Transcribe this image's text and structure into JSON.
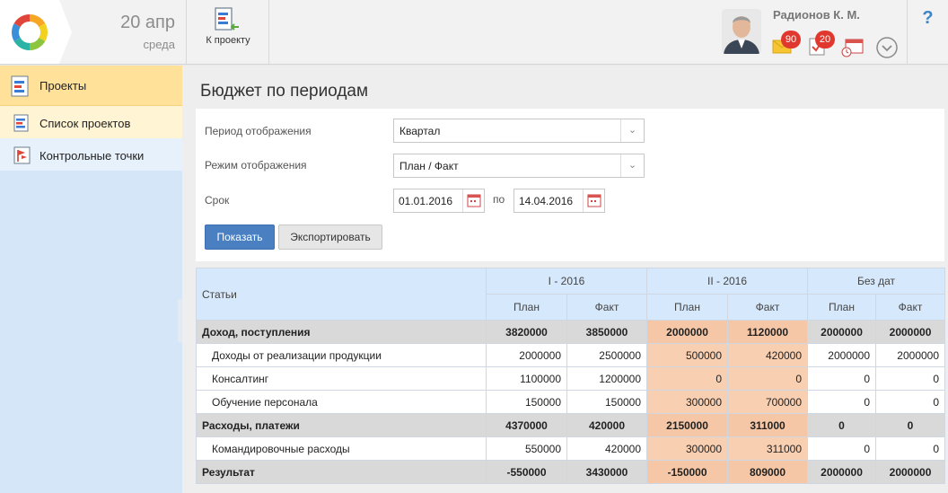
{
  "header": {
    "date_day": "20 апр",
    "date_weekday": "среда",
    "to_project_label": "К проекту",
    "user_name": "Радионов К. М.",
    "mail_badge": "90",
    "tasks_badge": "20",
    "help_label": "?"
  },
  "sidebar": {
    "main_item": "Проекты",
    "items": [
      {
        "label": "Список проектов"
      },
      {
        "label": "Контрольные точки"
      }
    ]
  },
  "page": {
    "title": "Бюджет по периодам"
  },
  "form": {
    "period_label": "Период отображения",
    "period_value": "Квартал",
    "mode_label": "Режим отображения",
    "mode_value": "План / Факт",
    "term_label": "Срок",
    "date_from": "01.01.2016",
    "to_label": "по",
    "date_to": "14.04.2016",
    "show_button": "Показать",
    "export_button": "Экспортировать"
  },
  "table": {
    "items_header": "Статьи",
    "periods": [
      "I - 2016",
      "II - 2016",
      "Без дат"
    ],
    "plan": "План",
    "fact": "Факт",
    "rows": [
      {
        "name": "Доход, поступления",
        "group": true,
        "values": [
          "3820000",
          "3850000",
          "2000000",
          "1120000",
          "2000000",
          "2000000"
        ]
      },
      {
        "name": "Доходы от реализации продукции",
        "group": false,
        "values": [
          "2000000",
          "2500000",
          "500000",
          "420000",
          "2000000",
          "2000000"
        ]
      },
      {
        "name": "Консалтинг",
        "group": false,
        "values": [
          "1100000",
          "1200000",
          "0",
          "0",
          "0",
          "0"
        ]
      },
      {
        "name": "Обучение персонала",
        "group": false,
        "values": [
          "150000",
          "150000",
          "300000",
          "700000",
          "0",
          "0"
        ]
      },
      {
        "name": "Расходы, платежи",
        "group": true,
        "values": [
          "4370000",
          "420000",
          "2150000",
          "311000",
          "0",
          "0"
        ]
      },
      {
        "name": "Командировочные расходы",
        "group": false,
        "values": [
          "550000",
          "420000",
          "300000",
          "311000",
          "0",
          "0"
        ]
      },
      {
        "name": "Результат",
        "group": true,
        "values": [
          "-550000",
          "3430000",
          "-150000",
          "809000",
          "2000000",
          "2000000"
        ]
      }
    ]
  },
  "colors": {
    "accent": "#4a80c2",
    "highlight": "#f9cfb2",
    "sidebar": "#d4e6f8",
    "badge": "#e0382e"
  }
}
